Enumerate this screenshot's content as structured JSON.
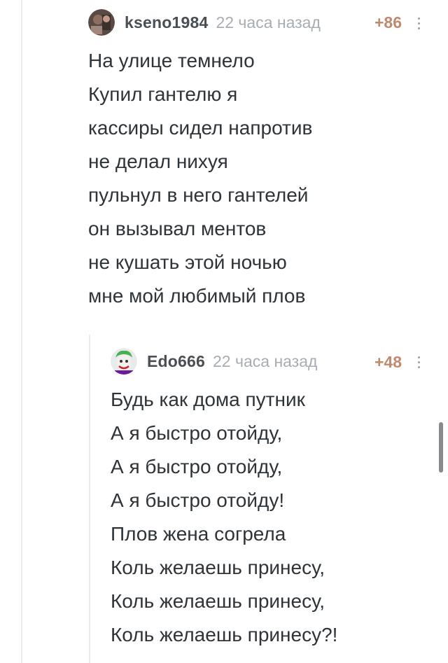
{
  "comments": [
    {
      "username": "kseno1984",
      "timestamp": "22 часа назад",
      "rating": "+86",
      "avatar_icon": "user-avatar-photo",
      "lines": [
        "На улице темнело",
        "Купил гантелю я",
        "кассиры сидел напротив",
        "не делал нихуя",
        "пульнул в него гантелей",
        "он вызывал ментов",
        "не кушать этой ночью",
        "мне мой любимый плов"
      ]
    },
    {
      "username": "Edo666",
      "timestamp": "22 часа назад",
      "rating": "+48",
      "avatar_icon": "joker-avatar",
      "lines": [
        "Будь как дома путник",
        "А я быстро отойду,",
        "А я быстро отойду,",
        "А я быстро отойду!",
        "Плов жена согрела",
        "Коль желаешь принесу,",
        "Коль желаешь принесу,",
        "Коль желаешь принесу?!"
      ]
    }
  ],
  "colors": {
    "username": "#4a4f54",
    "timestamp": "#a7adb3",
    "rating": "#c08a6f",
    "text": "#2f3438",
    "thread_line": "#e9ecee"
  }
}
